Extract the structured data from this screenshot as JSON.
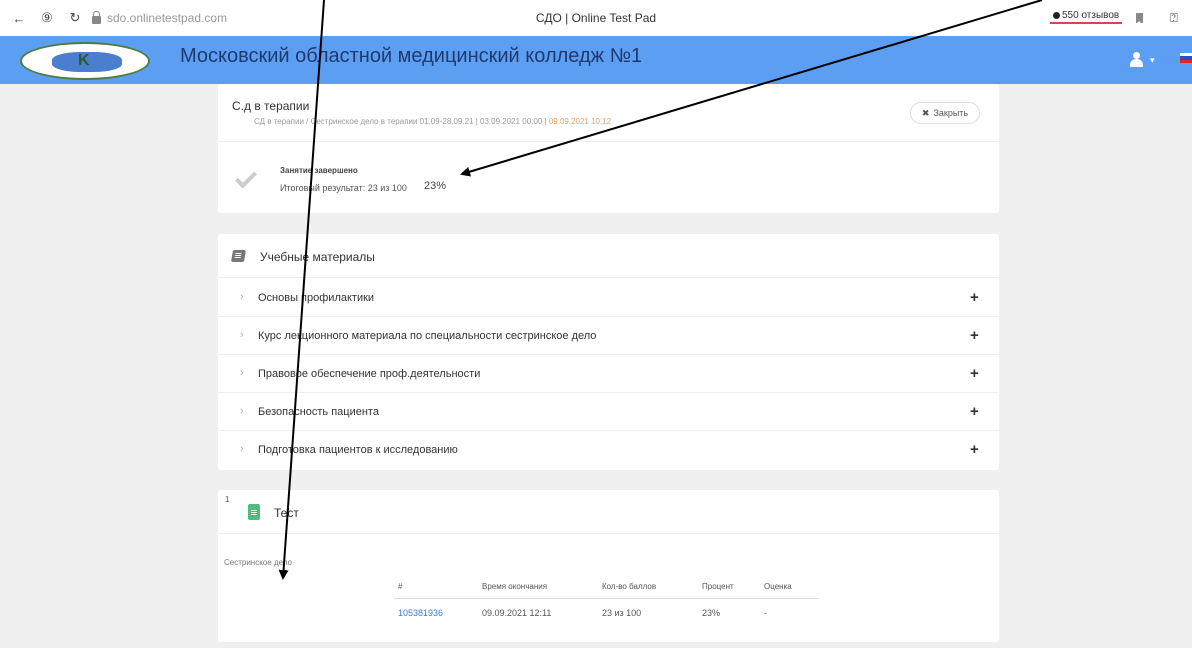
{
  "browser": {
    "url": "sdo.onlinetestpad.com",
    "tab_title": "СДО | Online Test Pad",
    "reviews": "550 отзывов",
    "back_icon": "←",
    "yandex_icon": "⑨",
    "reload_icon": "↻"
  },
  "header": {
    "site_title": "Московский областной медицинский колледж №1",
    "caret": "▾"
  },
  "course": {
    "name": "С.д в терапии",
    "meta_main": "СД в терапии / Сестринское дело в терапии 01.09-28.09.21   |   03.09.2021 00:00   |   ",
    "meta_deadline": "09.09.2021 10:12",
    "close_label": "Закрыть",
    "close_icon": "✖",
    "status": "Занятие завершено",
    "result_label": "Итоговый результат: 23 из 100",
    "result_percent": "23%"
  },
  "materials": {
    "title": "Учебные материалы",
    "chevron": "›",
    "plus": "+",
    "items": [
      {
        "label": "Основы профилактики"
      },
      {
        "label": "Курс лекционного материала по специальности сестринское дело"
      },
      {
        "label": "Правовое обеспечение проф.деятельности"
      },
      {
        "label": "Безопасность пациента"
      },
      {
        "label": "Подготовка пациентов к исследованию"
      }
    ]
  },
  "test": {
    "number": "1",
    "title": "Тест",
    "subtitle": "Сестринское дело",
    "columns": [
      "#",
      "Время окончания",
      "Кол-во баллов",
      "Процент",
      "Оценка"
    ],
    "row": [
      "105381936",
      "09.09.2021 12:11",
      "23 из 100",
      "23%",
      "-"
    ]
  }
}
